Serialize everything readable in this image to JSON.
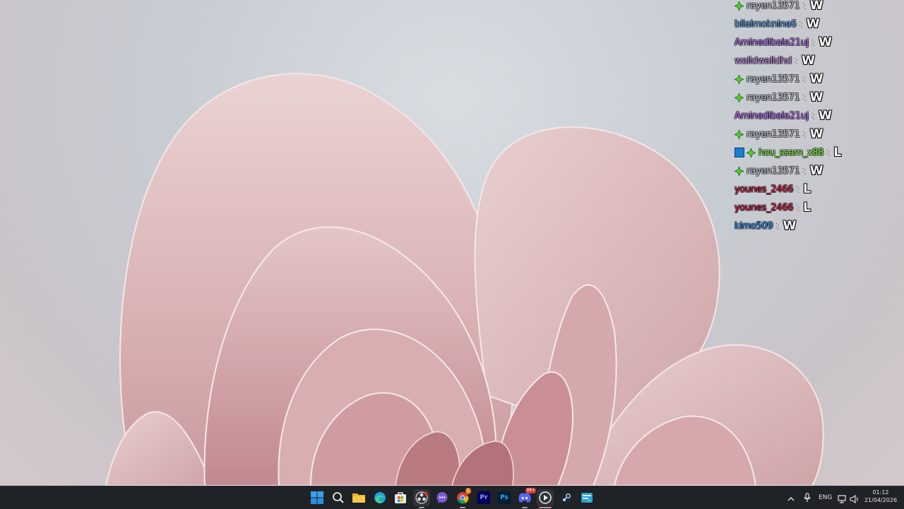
{
  "chat": [
    {
      "user": "rayen13571",
      "msg": "W",
      "cls": "rayen",
      "badge": "star"
    },
    {
      "user": "bilalmoknine6",
      "msg": "W",
      "cls": "bilal",
      "badge": ""
    },
    {
      "user": "Aminedibala21uj",
      "msg": "W",
      "cls": "amine",
      "badge": ""
    },
    {
      "user": "walidwalidhd",
      "msg": "W",
      "cls": "walid",
      "badge": ""
    },
    {
      "user": "rayen13571",
      "msg": "W",
      "cls": "rayen",
      "badge": "star"
    },
    {
      "user": "rayen13571",
      "msg": "W",
      "cls": "rayen",
      "badge": "star"
    },
    {
      "user": "Aminedibala21uj",
      "msg": "W",
      "cls": "amine",
      "badge": ""
    },
    {
      "user": "rayen13571",
      "msg": "W",
      "cls": "rayen",
      "badge": "star"
    },
    {
      "user": "hou_ssam_x88",
      "msg": "L",
      "cls": "hou",
      "badge": "mod-star"
    },
    {
      "user": "rayen13571",
      "msg": "W",
      "cls": "rayen",
      "badge": "star"
    },
    {
      "user": "younes_2466",
      "msg": "L",
      "cls": "younes",
      "badge": ""
    },
    {
      "user": "younes_2466",
      "msg": "L",
      "cls": "younes",
      "badge": ""
    },
    {
      "user": "kimo509",
      "msg": "W",
      "cls": "kimo",
      "badge": ""
    }
  ],
  "separator": ":",
  "taskbar": {
    "apps": [
      {
        "name": "start-button",
        "icon": "windows-icon"
      },
      {
        "name": "search-button",
        "icon": "search-icon"
      },
      {
        "name": "file-explorer-button",
        "icon": "folder-icon"
      },
      {
        "name": "edge-button",
        "icon": "edge-icon"
      },
      {
        "name": "store-button",
        "icon": "store-icon"
      },
      {
        "name": "obs-button",
        "icon": "obs-icon"
      },
      {
        "name": "chat-app-button",
        "icon": "chat-icon"
      },
      {
        "name": "chrome-button",
        "icon": "chrome-icon"
      },
      {
        "name": "premiere-button",
        "icon": "premiere-icon"
      },
      {
        "name": "photoshop-button",
        "icon": "photoshop-icon"
      },
      {
        "name": "discord-button",
        "icon": "discord-icon"
      },
      {
        "name": "media-player-button",
        "icon": "play-icon"
      },
      {
        "name": "steam-button",
        "icon": "steam-icon"
      },
      {
        "name": "app-button",
        "icon": "app-icon"
      }
    ],
    "badges": {
      "chrome": "1",
      "discord": "99+"
    },
    "labels": {
      "premiere": "Pr",
      "photoshop": "Ps"
    },
    "language": "ENG",
    "time": "01:12",
    "date": "21/04/2026"
  }
}
